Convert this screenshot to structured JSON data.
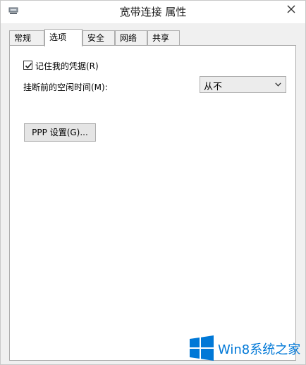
{
  "window": {
    "title": "宽带连接 属性",
    "close_icon": "close-icon",
    "system_icon": "network-connection-icon"
  },
  "tabs": [
    {
      "label": "常规",
      "active": false
    },
    {
      "label": "选项",
      "active": true
    },
    {
      "label": "安全",
      "active": false
    },
    {
      "label": "网络",
      "active": false
    },
    {
      "label": "共享",
      "active": false
    }
  ],
  "options": {
    "remember_credentials": {
      "label": "记住我的凭据(R)",
      "checked": true
    },
    "idle_time": {
      "label": "挂断前的空闲时间(M):",
      "selected_value": "从不"
    },
    "ppp_button_label": "PPP 设置(G)..."
  },
  "watermark": {
    "text": "Win8系统之家",
    "color": "#0078d7"
  },
  "colors": {
    "window_bg": "#f0f0f0",
    "panel_bg": "#ffffff",
    "border": "#adadad",
    "watermark_blue": "#0078d7"
  }
}
